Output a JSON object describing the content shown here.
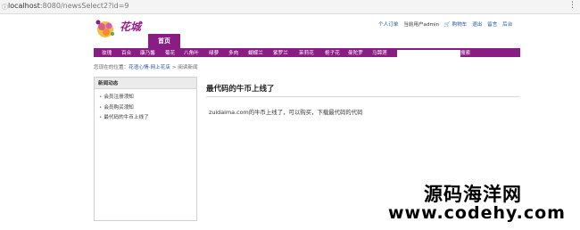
{
  "browser": {
    "url_host": "localhost",
    "url_rest": ":8080/newsSelect2?id=9",
    "menu_glyph": "⋮"
  },
  "header": {
    "logo_text": "花城",
    "links": {
      "orders": "个人订单",
      "current_user": "当前用户admin",
      "cart_icon": "🛒",
      "cart": "购物车",
      "logout": "退出",
      "message": "留言",
      "backend": "后台"
    }
  },
  "nav": {
    "home": "首页",
    "items": [
      "玫瑰",
      "百合",
      "康乃馨",
      "菊花",
      "八角叶",
      "绿萝",
      "多肉",
      "蝴蝶兰",
      "紫罗兰",
      "茉莉花",
      "栀子花",
      "曼陀罗",
      "马蹄莲"
    ],
    "search_placeholder": "",
    "search_button": "搜索"
  },
  "breadcrumb": {
    "prefix": "您现在的位置：",
    "site": "花语心情-网上花店",
    "separator": " > ",
    "current": "阅读新闻"
  },
  "sidebar": {
    "title": "新闻动态",
    "items": [
      "会员注册须知",
      "会员购买须知",
      "最代码的牛币上线了"
    ]
  },
  "article": {
    "title": "最代码的牛币上线了",
    "body": "zuidaima.com的牛币上线了，可以购买，下载最代码的代码"
  },
  "watermark": {
    "line1": "源码海洋网",
    "line2": "www.codehy.com"
  },
  "colors": {
    "nav_bg": "#8a1d84",
    "link": "#2255aa"
  }
}
